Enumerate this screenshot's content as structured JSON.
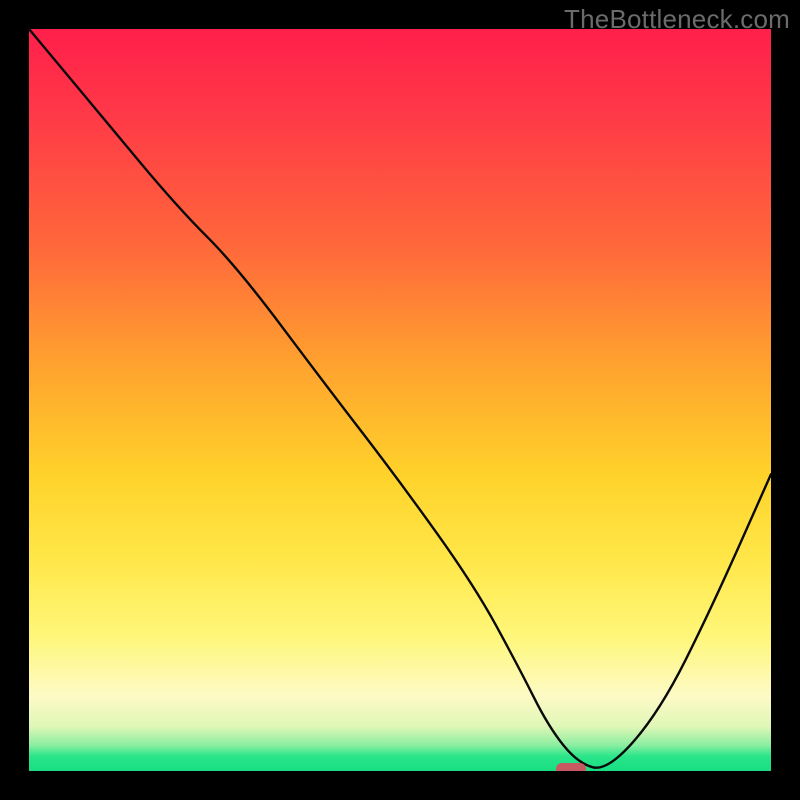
{
  "watermark": "TheBottleneck.com",
  "chart_data": {
    "type": "line",
    "title": "",
    "xlabel": "",
    "ylabel": "",
    "ylim": [
      0,
      100
    ],
    "xlim": [
      0,
      100
    ],
    "x": [
      0,
      10,
      20,
      28,
      40,
      50,
      60,
      66,
      70,
      74,
      78,
      85,
      92,
      100
    ],
    "values": [
      100,
      88,
      76,
      68,
      52,
      39,
      25,
      14,
      6,
      1,
      0,
      8,
      22,
      40
    ],
    "marker": {
      "x": 73,
      "y": 0
    }
  },
  "colors": {
    "curve": "#0a0a0a",
    "pill": "#c65a60",
    "background_frame": "#000000"
  }
}
